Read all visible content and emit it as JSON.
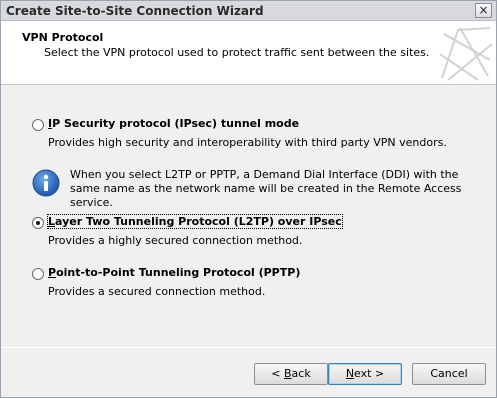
{
  "window": {
    "title": "Create Site-to-Site Connection Wizard",
    "close_glyph": "×"
  },
  "header": {
    "title": "VPN Protocol",
    "subtitle": "Select the VPN protocol used to protect traffic sent between the sites."
  },
  "options": [
    {
      "label_ak": "I",
      "label_rest": "P Security protocol (IPsec) tunnel mode",
      "description": "Provides high security and interoperability with third party VPN vendors.",
      "selected": false
    },
    {
      "label_ak": "L",
      "label_rest": "ayer Two Tunneling Protocol (L2TP) over IPsec",
      "description": "Provides a highly secured connection method.",
      "selected": true
    },
    {
      "label_ak": "P",
      "label_rest": "oint-to-Point Tunneling Protocol (PPTP)",
      "description": "Provides a secured connection method.",
      "selected": false
    }
  ],
  "info": {
    "icon": "info-icon",
    "text": "When you select L2TP or PPTP, a Demand Dial Interface (DDI) with the same name as the network name will be created in the Remote Access service."
  },
  "buttons": {
    "back_prefix": "< ",
    "back_ak": "B",
    "back_rest": "ack",
    "next_ak": "N",
    "next_rest": "ext >",
    "cancel": "Cancel"
  },
  "colors": {
    "accent": "#3c7fb1",
    "info_icon": "#2a66b8"
  }
}
